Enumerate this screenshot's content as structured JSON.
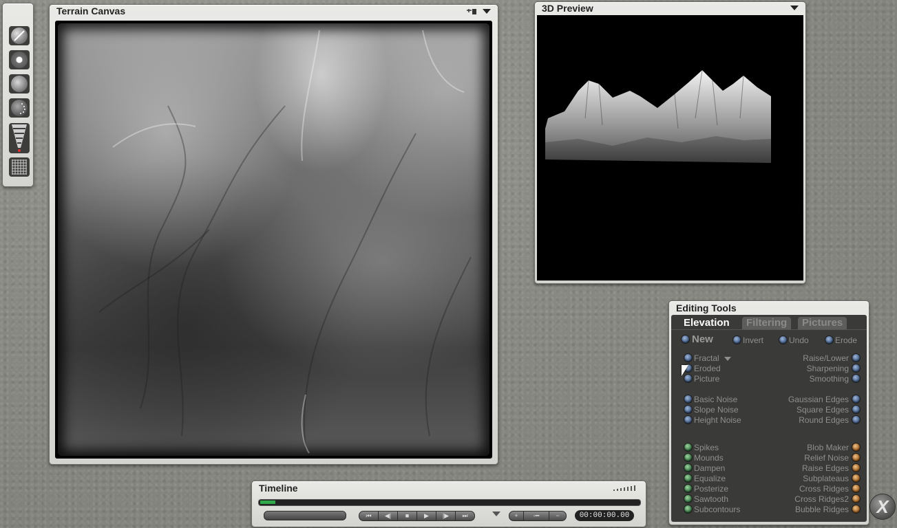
{
  "terrain_canvas": {
    "title": "Terrain Canvas"
  },
  "preview": {
    "title": "3D Preview"
  },
  "timeline": {
    "title": "Timeline",
    "time": "00:00:00.00"
  },
  "editing_tools": {
    "title": "Editing Tools",
    "tabs": [
      "Elevation",
      "Filtering",
      "Pictures"
    ],
    "top_row": {
      "new": "New",
      "invert": "Invert",
      "undo": "Undo",
      "erode": "Erode"
    },
    "left_group1": [
      "Fractal",
      "Eroded",
      "Picture"
    ],
    "right_group1": [
      "Raise/Lower",
      "Sharpening",
      "Smoothing"
    ],
    "left_group2": [
      "Basic Noise",
      "Slope Noise",
      "Height Noise"
    ],
    "right_group2": [
      "Gaussian Edges",
      "Square Edges",
      "Round Edges"
    ],
    "left_group3": [
      "Spikes",
      "Mounds",
      "Dampen",
      "Equalize",
      "Posterize",
      "Sawtooth",
      "Subcontours"
    ],
    "right_group3": [
      "Blob Maker",
      "Relief Noise",
      "Raise Edges",
      "Subplateaus",
      "Cross Ridges",
      "Cross Ridges2",
      "Bubble Ridges"
    ]
  },
  "exit": {
    "label": "X"
  }
}
